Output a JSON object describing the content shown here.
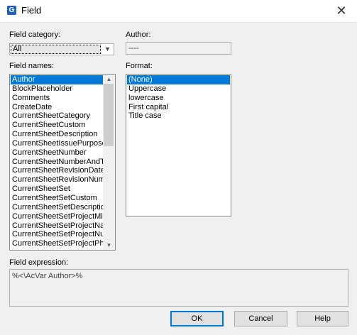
{
  "window": {
    "title": "Field",
    "icon": "app-logo-icon",
    "close_glyph": "✕"
  },
  "field_category": {
    "label": "Field category:",
    "selected": "All"
  },
  "author": {
    "label": "Author:",
    "value": "----"
  },
  "field_names": {
    "label": "Field names:",
    "items": [
      "Author",
      "BlockPlaceholder",
      "Comments",
      "CreateDate",
      "CurrentSheetCategory",
      "CurrentSheetCustom",
      "CurrentSheetDescription",
      "CurrentSheetIssuePurpose",
      "CurrentSheetNumber",
      "CurrentSheetNumberAndTitle",
      "CurrentSheetRevisionDate",
      "CurrentSheetRevisionNumber",
      "CurrentSheetSet",
      "CurrentSheetSetCustom",
      "CurrentSheetSetDescription",
      "CurrentSheetSetProjectMilestone",
      "CurrentSheetSetProjectName",
      "CurrentSheetSetProjectNumber",
      "CurrentSheetSetProjectPhase"
    ],
    "selected_index": 0
  },
  "format": {
    "label": "Format:",
    "items": [
      "(None)",
      "Uppercase",
      "lowercase",
      "First capital",
      "Title case"
    ],
    "selected_index": 0
  },
  "field_expression": {
    "label": "Field expression:",
    "value": "%<\\AcVar Author>%"
  },
  "buttons": {
    "ok": "OK",
    "cancel": "Cancel",
    "help": "Help"
  }
}
